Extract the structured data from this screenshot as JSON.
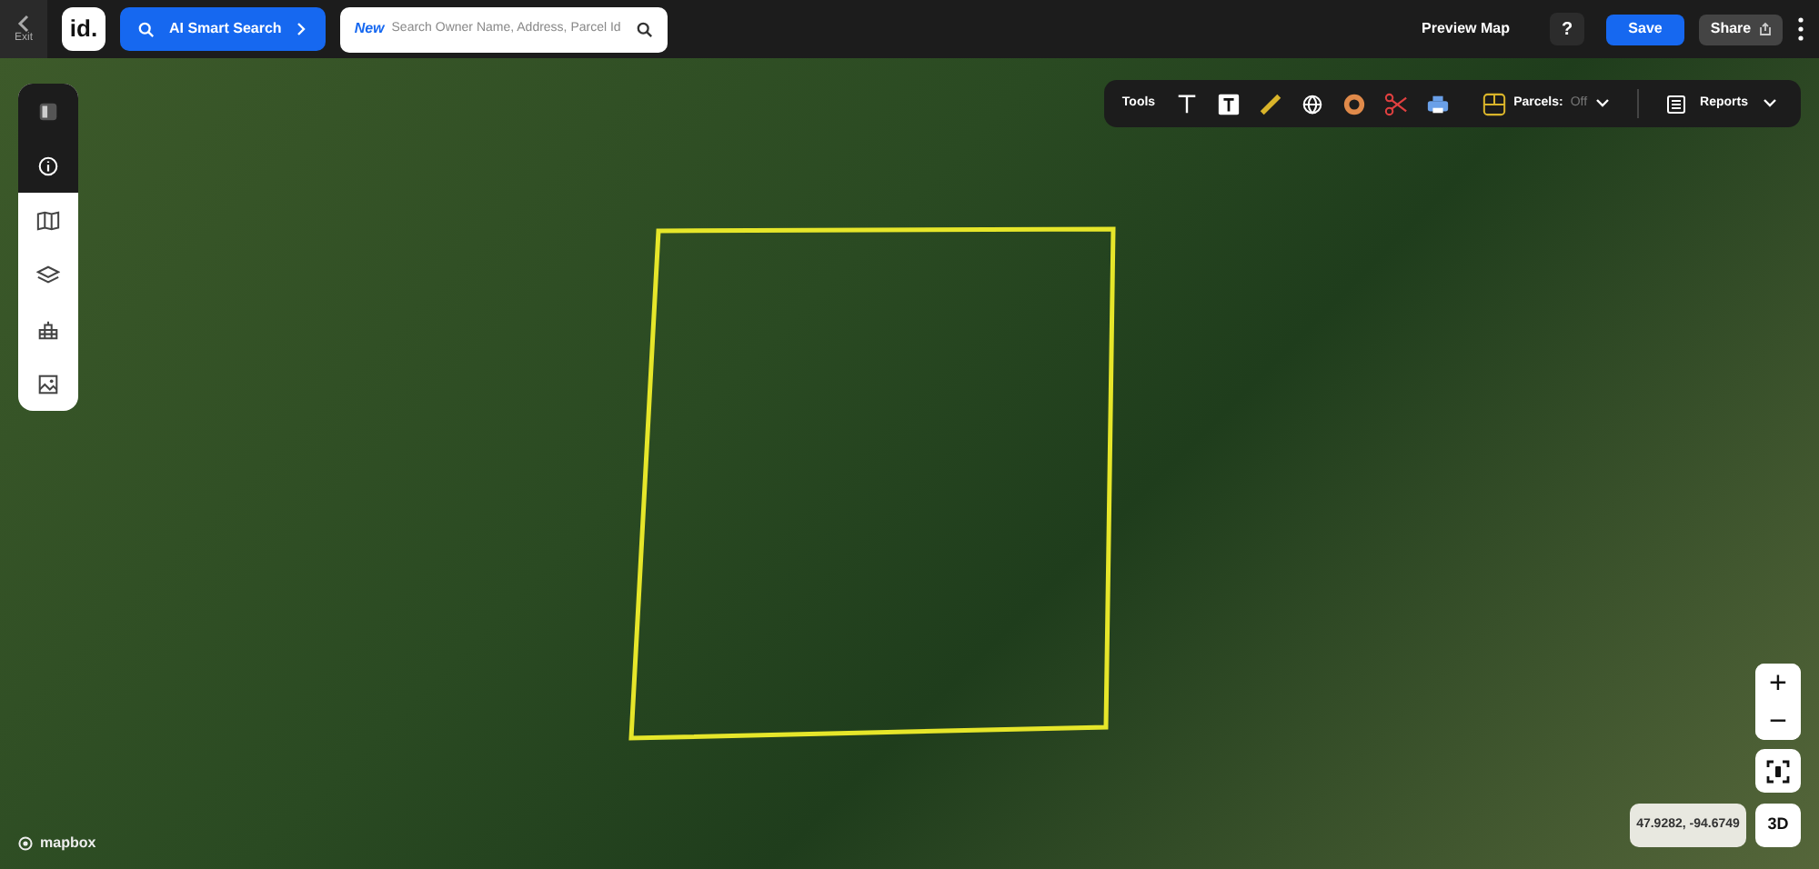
{
  "top_bar": {
    "exit_label": "Exit",
    "logo": "id.",
    "ai_search": {
      "label": "AI Smart Search"
    },
    "search": {
      "badge": "New",
      "placeholder": "Search Owner Name, Address, Parcel Id"
    },
    "preview": "Preview Map",
    "help": "?",
    "save": "Save",
    "share": "Share"
  },
  "sidebar": {
    "header_items": [
      {
        "kind": "panel"
      },
      {
        "kind": "info"
      }
    ],
    "items": [
      {
        "kind": "map"
      },
      {
        "kind": "layers"
      },
      {
        "kind": "buildings"
      },
      {
        "kind": "image"
      }
    ]
  },
  "toolbar": {
    "label": "Tools",
    "tools": [
      {
        "kind": "text"
      },
      {
        "kind": "textbox"
      },
      {
        "kind": "ruler"
      },
      {
        "kind": "globe"
      },
      {
        "kind": "ring"
      },
      {
        "kind": "scissors"
      },
      {
        "kind": "printer"
      }
    ],
    "parcels": {
      "label": "Parcels:",
      "value": "Off"
    },
    "reports": {
      "label": "Reports"
    }
  },
  "map_controls": {
    "zoom_in": "+",
    "zoom_out": "−",
    "coordinates": "47.9282, -94.6749",
    "view_3d": "3D"
  },
  "attribution": "mapbox"
}
